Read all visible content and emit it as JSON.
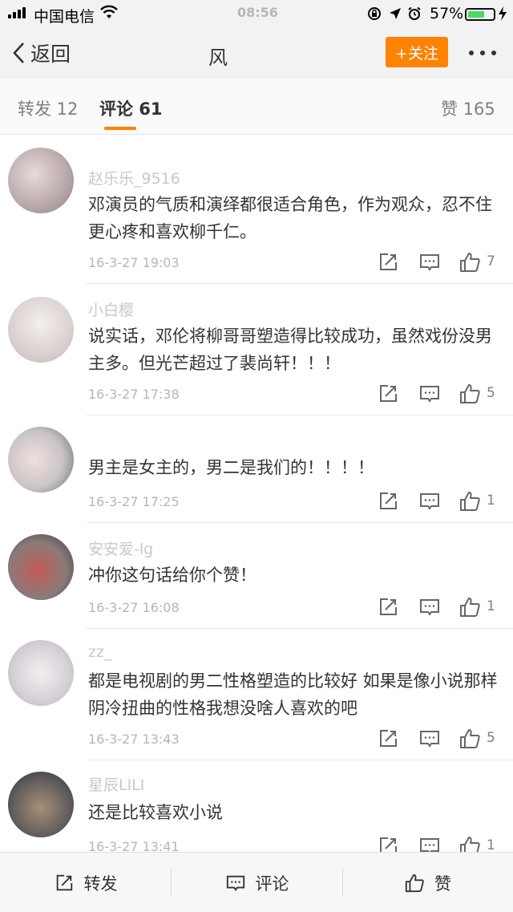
{
  "status_bar": {
    "carrier": "中国电信",
    "time": "08:56",
    "battery": "57%",
    "battery_level": 0.57
  },
  "nav": {
    "back_label": "返回",
    "title": "风",
    "follow_label": "+关注"
  },
  "tabs": {
    "repost": "转发 12",
    "comment": "评论 61",
    "like": "赞 165"
  },
  "comments": [
    {
      "username": "",
      "text": "",
      "time": "",
      "likes": ""
    },
    {
      "username": "赵乐乐_9516",
      "text": "邓演员的气质和演绎都很适合角色，作为观众，忍不住更心疼和喜欢柳千仁。",
      "time": "16-3-27 19:03",
      "likes": "7"
    },
    {
      "username": "小白樱",
      "text": "说实话，邓伦将柳哥哥塑造得比较成功，虽然戏份没男主多。但光芒超过了裴尚轩！！！",
      "time": "16-3-27 17:38",
      "likes": "5"
    },
    {
      "username": "",
      "text": "男主是女主的，男二是我们的！！！！",
      "time": "16-3-27 17:25",
      "likes": "1"
    },
    {
      "username": "安安爱-lg",
      "text": "冲你这句话给你个赞！",
      "time": "16-3-27 16:08",
      "likes": "1"
    },
    {
      "username": "zz_",
      "text": "都是电视剧的男二性格塑造的比较好 如果是像小说那样阴冷扭曲的性格我想没啥人喜欢的吧",
      "time": "16-3-27 13:43",
      "likes": "5"
    },
    {
      "username": "星辰LILI",
      "text": "还是比较喜欢小说",
      "time": "16-3-27 13:41",
      "likes": "1"
    }
  ],
  "bottom_bar": {
    "repost": "转发",
    "comment": "评论",
    "like": "赞"
  },
  "colors": {
    "accent": "#ff8200",
    "text": "#333333",
    "muted": "#b6b6b6"
  }
}
